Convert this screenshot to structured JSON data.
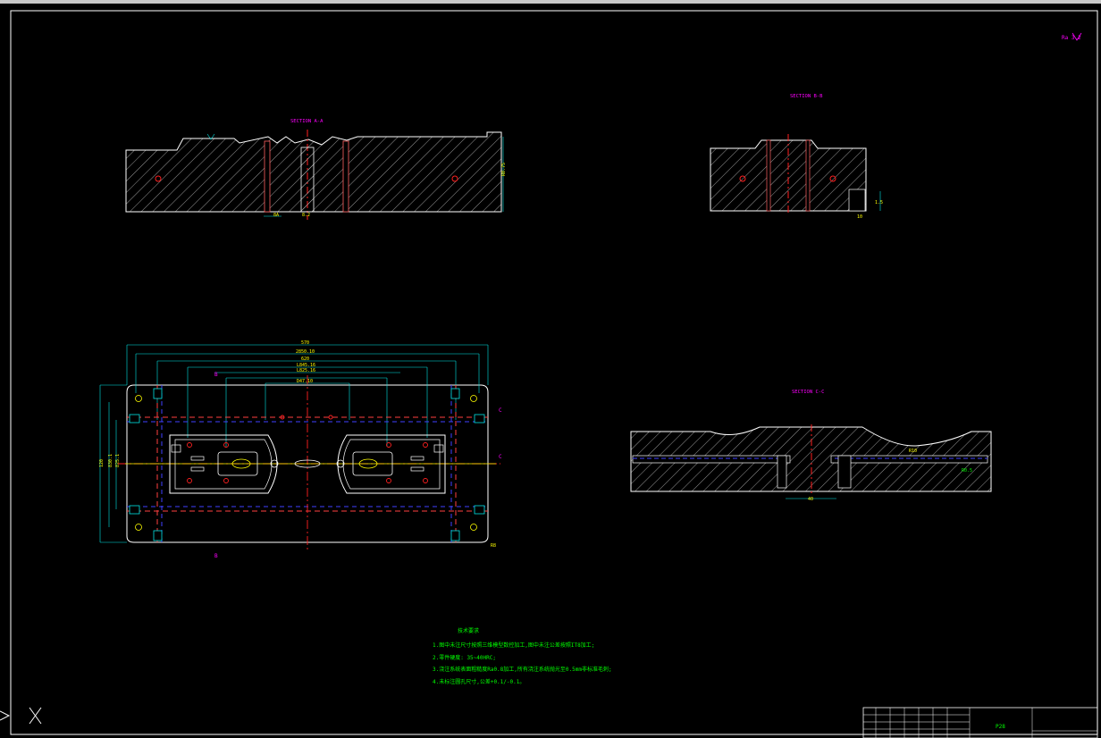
{
  "drawing": {
    "section_labels": {
      "aa": "SECTION A-A",
      "bb": "SECTION B-B",
      "cc": "SECTION C-C"
    },
    "corner_mark": "Ra 3.2",
    "section_markers": {
      "b_top": "B",
      "b_bottom": "B",
      "c_right": "C",
      "c_right2": "C"
    },
    "dims": {
      "aa_height": "R0.75",
      "aa_small_1": "8A",
      "aa_small_2": "8.2",
      "bb_a": "10",
      "bb_b": "1.5",
      "cc_width": "40",
      "cc_r": "R10",
      "cc_note": "R0.5",
      "plan_w1": "570",
      "plan_w2": "2850.10",
      "plan_w3": "620",
      "plan_w4": "L845.16",
      "plan_w5": "L825.16",
      "plan_w6": "D47.10",
      "plan_h1": "120",
      "plan_h2": "830.1",
      "plan_h3": "825.1",
      "plan_corner": "R8"
    },
    "notes": {
      "title": "技术要求",
      "lines": [
        "1.图中未注尺寸按照三维模型数控加工,图中未注公差按照IT8加工;",
        "2.零件硬度: 35~40HRC;",
        "3.浇注系统表面粗糙度Ra0.8加工,所有浇注系统抛光至0.5mm非标准毛刺;",
        "4.未标注圆孔尺寸,公差+0.1/-0.1。"
      ]
    },
    "title_block": {
      "label": "P28"
    }
  },
  "colors": {
    "bg": "#000000",
    "outline": "#ffffff",
    "hatch": "#ffffff",
    "center": "#ff2020",
    "dim": "#00e5e5",
    "label": "#ff00ff",
    "note": "#00ff00",
    "yellow": "#ffff00"
  },
  "icons": {
    "ucs": "ucs-icon",
    "x_axis": "x-axis-icon"
  }
}
